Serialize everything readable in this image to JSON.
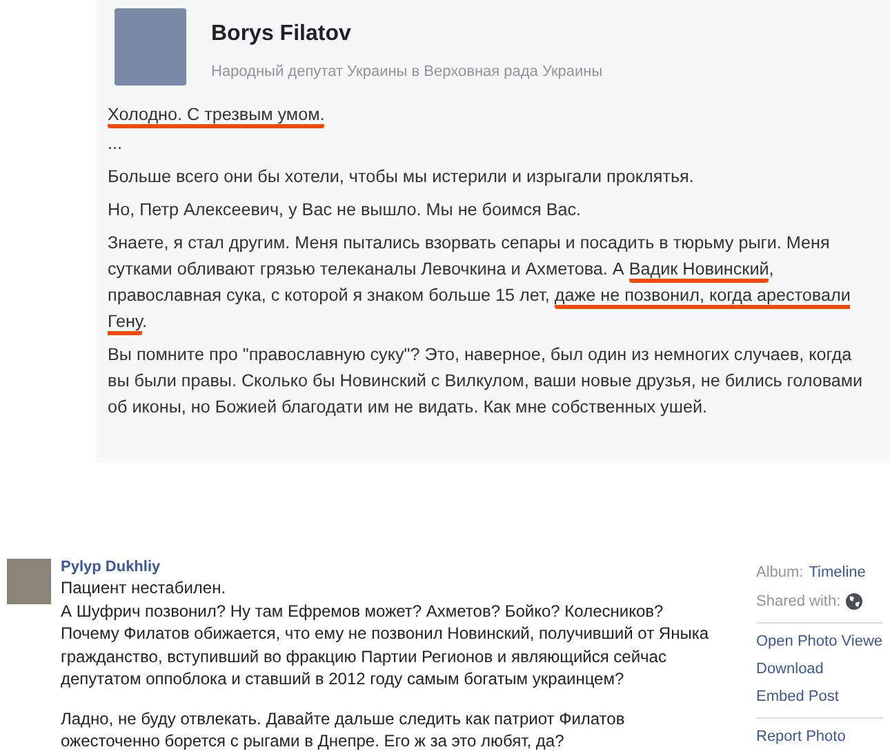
{
  "post_image": {
    "author": {
      "name": "Borys Filatov",
      "subtitle": "Народный депутат Украины в Верховная рада Украины"
    },
    "paragraphs": [
      [
        {
          "text": "Холодно. С трезвым умом.",
          "underlined": true
        }
      ],
      [
        {
          "text": "...",
          "underlined": false
        }
      ],
      [
        {
          "text": "Больше всего они бы хотели, чтобы мы истерили и изрыгали проклятья.",
          "underlined": false
        }
      ],
      [
        {
          "text": "Но, Петр Алексеевич, у Вас не вышло. Мы не боимся Вас.",
          "underlined": false
        }
      ],
      [
        {
          "text": "Знаете, я стал другим. Меня пытались взорвать сепары и посадить в тюрьму рыги. Меня сутками обливают грязью телеканалы Левочкина и Ахметова. А ",
          "underlined": false
        },
        {
          "text": "Вадик Новинский",
          "underlined": true
        },
        {
          "text": ", православная сука, с которой я знаком больше 15 лет, ",
          "underlined": false
        },
        {
          "text": "даже не позвонил, когда арестовали Гену",
          "underlined": true
        },
        {
          "text": ".",
          "underlined": false
        }
      ],
      [
        {
          "text": "Вы помните про \"православную суку\"? Это, наверное, был один из немногих случаев, когда вы были правы. Сколько бы Новинский с Вилкулом, ваши новые друзья, не бились головами об иконы, но Божией благодати им не видать. Как мне собственных ушей.",
          "underlined": false
        }
      ]
    ]
  },
  "comment": {
    "author": "Pylyp Dukhliy",
    "paragraphs": [
      [
        "Пациент нестабилен.",
        "А Шуфрич позвонил? Ну там Ефремов может? Ахметов? Бойко? Колесников?",
        "Почему Филатов обижается, что ему не позвонил Новинский, получивший от Яныка",
        "гражданство, вступивший во фракцию Партии Регионов и являющийся сейчас",
        "депутатом оппоблока и ставший в 2012 году самым богатым украинцем?"
      ],
      [
        "Ладно, не буду отвлекать. Давайте дальше следить как патриот Филатов",
        "ожесточенно борется с рыгами в Днепре. Его ж за это любят, да?"
      ]
    ]
  },
  "sidebar": {
    "album_label": "Album:",
    "album_value": "Timeline",
    "shared_label": "Shared with:",
    "actions": [
      [
        "Open Photo Viewe",
        "Download",
        "Embed Post"
      ],
      [
        "Report Photo"
      ]
    ]
  }
}
